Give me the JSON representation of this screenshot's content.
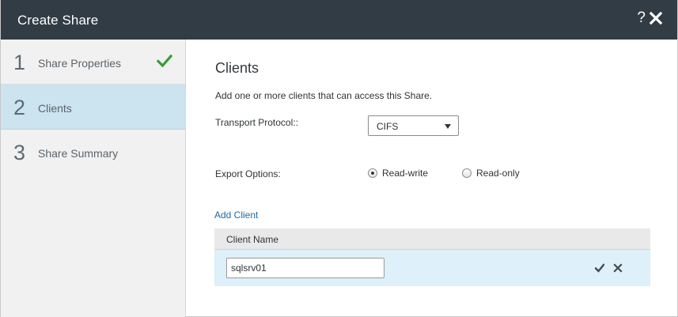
{
  "dialog": {
    "title": "Create Share",
    "help_label": "?"
  },
  "steps": [
    {
      "number": "1",
      "label": "Share Properties",
      "completed": true
    },
    {
      "number": "2",
      "label": "Clients",
      "active": true
    },
    {
      "number": "3",
      "label": "Share Summary"
    }
  ],
  "content": {
    "title": "Clients",
    "description": "Add one or more clients that can access this Share.",
    "transport_label": "Transport Protocol::",
    "transport_value": "CIFS",
    "export_label": "Export Options:",
    "export_options": [
      {
        "label": "Read-write",
        "checked": true
      },
      {
        "label": "Read-only",
        "checked": false
      }
    ],
    "add_client_label": "Add Client",
    "grid": {
      "column": "Client Name",
      "rows": [
        {
          "client_name": "sqlsrv01"
        }
      ]
    }
  },
  "colors": {
    "titlebar": "#313c45",
    "active_step": "#cce3f0",
    "check": "#3a9c3a",
    "link": "#1a6aa8",
    "row_highlight": "#def0f9"
  }
}
